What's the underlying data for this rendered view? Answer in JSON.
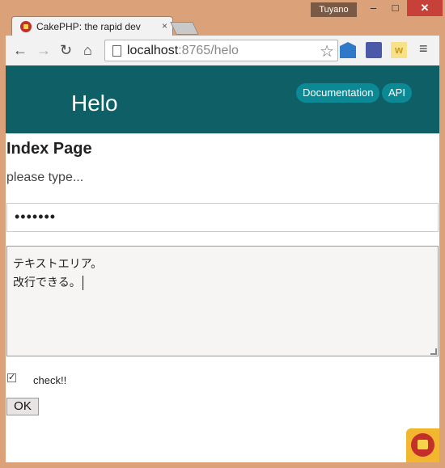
{
  "window": {
    "user": "Tuyano",
    "minimize": "‒",
    "maximize": "□",
    "close": "✕"
  },
  "tab": {
    "title": "CakePHP: the rapid dev",
    "close": "×"
  },
  "toolbar": {
    "url_host": "localhost",
    "url_path": ":8765/helo",
    "back_icon": "←",
    "forward_icon": "→",
    "reload_icon": "↻",
    "home_icon": "⌂",
    "star_icon": "☆",
    "menu_icon": "≡",
    "ext_w": "w"
  },
  "header": {
    "title": "Helo",
    "links": [
      "Documentation",
      "API"
    ]
  },
  "main": {
    "heading": "Index Page",
    "intro": "please type...",
    "password_mask": "•••••••",
    "textarea_lines": [
      "テキストエリア。",
      "改行できる。"
    ],
    "checkbox_checked": true,
    "checkbox_label": "check!!",
    "submit_label": "OK"
  },
  "colors": {
    "header_bg": "#0f5f67",
    "pill_bg": "#0b8a96",
    "frame": "#dba27a"
  }
}
